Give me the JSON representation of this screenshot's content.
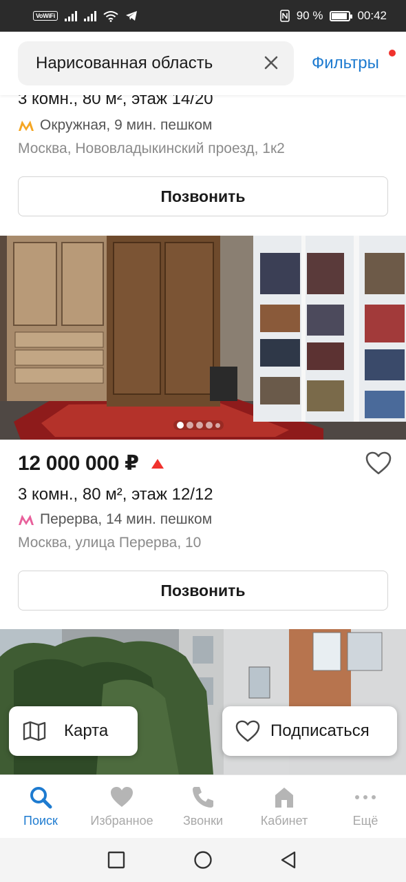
{
  "status_bar": {
    "vowifi": "VoWiFi",
    "battery_percent": "90 %",
    "time": "00:42"
  },
  "search": {
    "value": "Нарисованная область",
    "filters_label": "Фильтры",
    "filters_active": true
  },
  "listings": [
    {
      "rooms": "3 комн., 80 м², этаж 14/20",
      "metro": "Окружная, 9 мин. пешком",
      "metro_color": "#f5a623",
      "address": "Москва, Нововладыкинский проезд, 1к2",
      "call_label": "Позвонить"
    },
    {
      "photo_count": 5,
      "photo_active_index": 0,
      "price": "12 000 000 ₽",
      "price_trend": "up",
      "rooms": "3 комн., 80 м², этаж 12/12",
      "metro": "Перерва, 14 мин. пешком",
      "metro_color": "#e8609b",
      "address": "Москва, улица Перерва, 10",
      "call_label": "Позвонить"
    }
  ],
  "floating": {
    "map_label": "Карта",
    "subscribe_label": "Подписаться"
  },
  "tabs": [
    {
      "label": "Поиск",
      "icon": "search-icon",
      "active": true
    },
    {
      "label": "Избранное",
      "icon": "heart-icon",
      "active": false
    },
    {
      "label": "Звонки",
      "icon": "phone-icon",
      "active": false
    },
    {
      "label": "Кабинет",
      "icon": "home-icon",
      "active": false
    },
    {
      "label": "Ещё",
      "icon": "more-icon",
      "active": false
    }
  ],
  "colors": {
    "accent": "#1e7bd0",
    "alert": "#f0322d"
  }
}
